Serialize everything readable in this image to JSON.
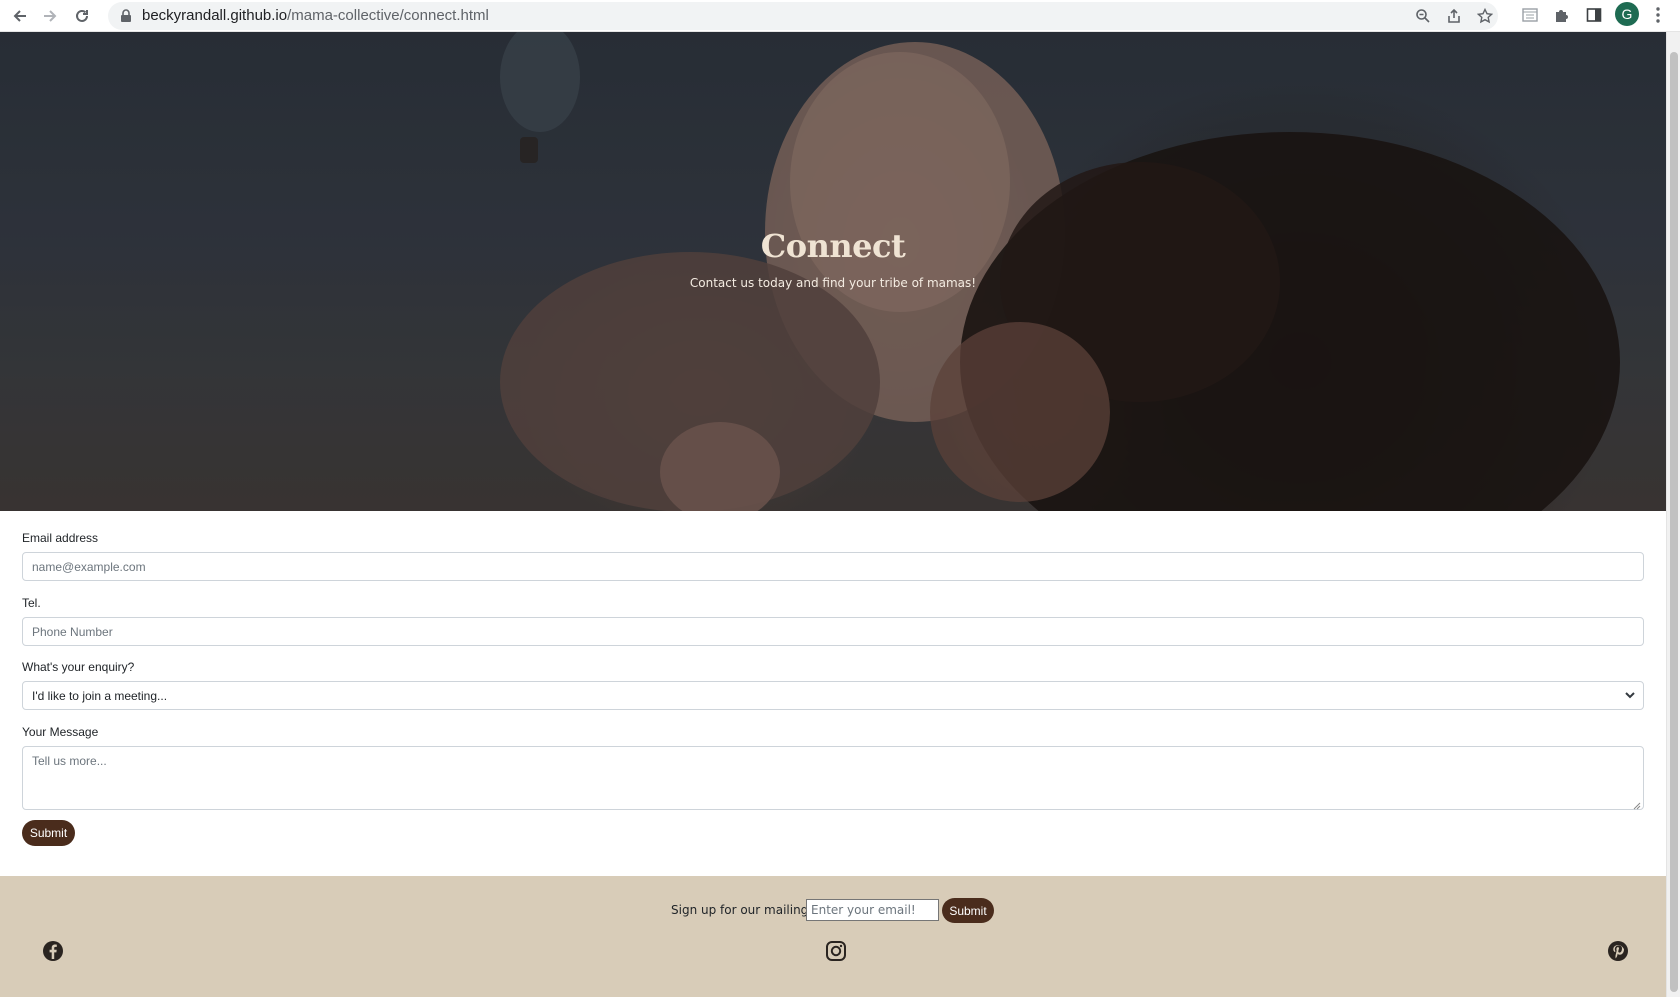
{
  "browser": {
    "url_host": "beckyrandall.github.io",
    "url_path": "/mama-collective/connect.html",
    "profile_initial": "G"
  },
  "hero": {
    "title": "Connect",
    "subtitle": "Contact us today and find your tribe of mamas!"
  },
  "form": {
    "email_label": "Email address",
    "email_placeholder": "name@example.com",
    "tel_label": "Tel.",
    "tel_placeholder": "Phone Number",
    "enquiry_label": "What's your enquiry?",
    "enquiry_selected": "I'd like to join a meeting...",
    "message_label": "Your Message",
    "message_placeholder": "Tell us more...",
    "submit_label": "Submit"
  },
  "footer": {
    "signup_label": "Sign up for our mailing list!",
    "signup_placeholder": "Enter your email!",
    "signup_button": "Submit",
    "social_icons": [
      "facebook-icon",
      "instagram-icon",
      "pinterest-icon"
    ]
  },
  "colors": {
    "brand_brown": "#4a2c1c",
    "footer_beige": "#d8ccb8",
    "hero_title": "#efe3d3"
  }
}
